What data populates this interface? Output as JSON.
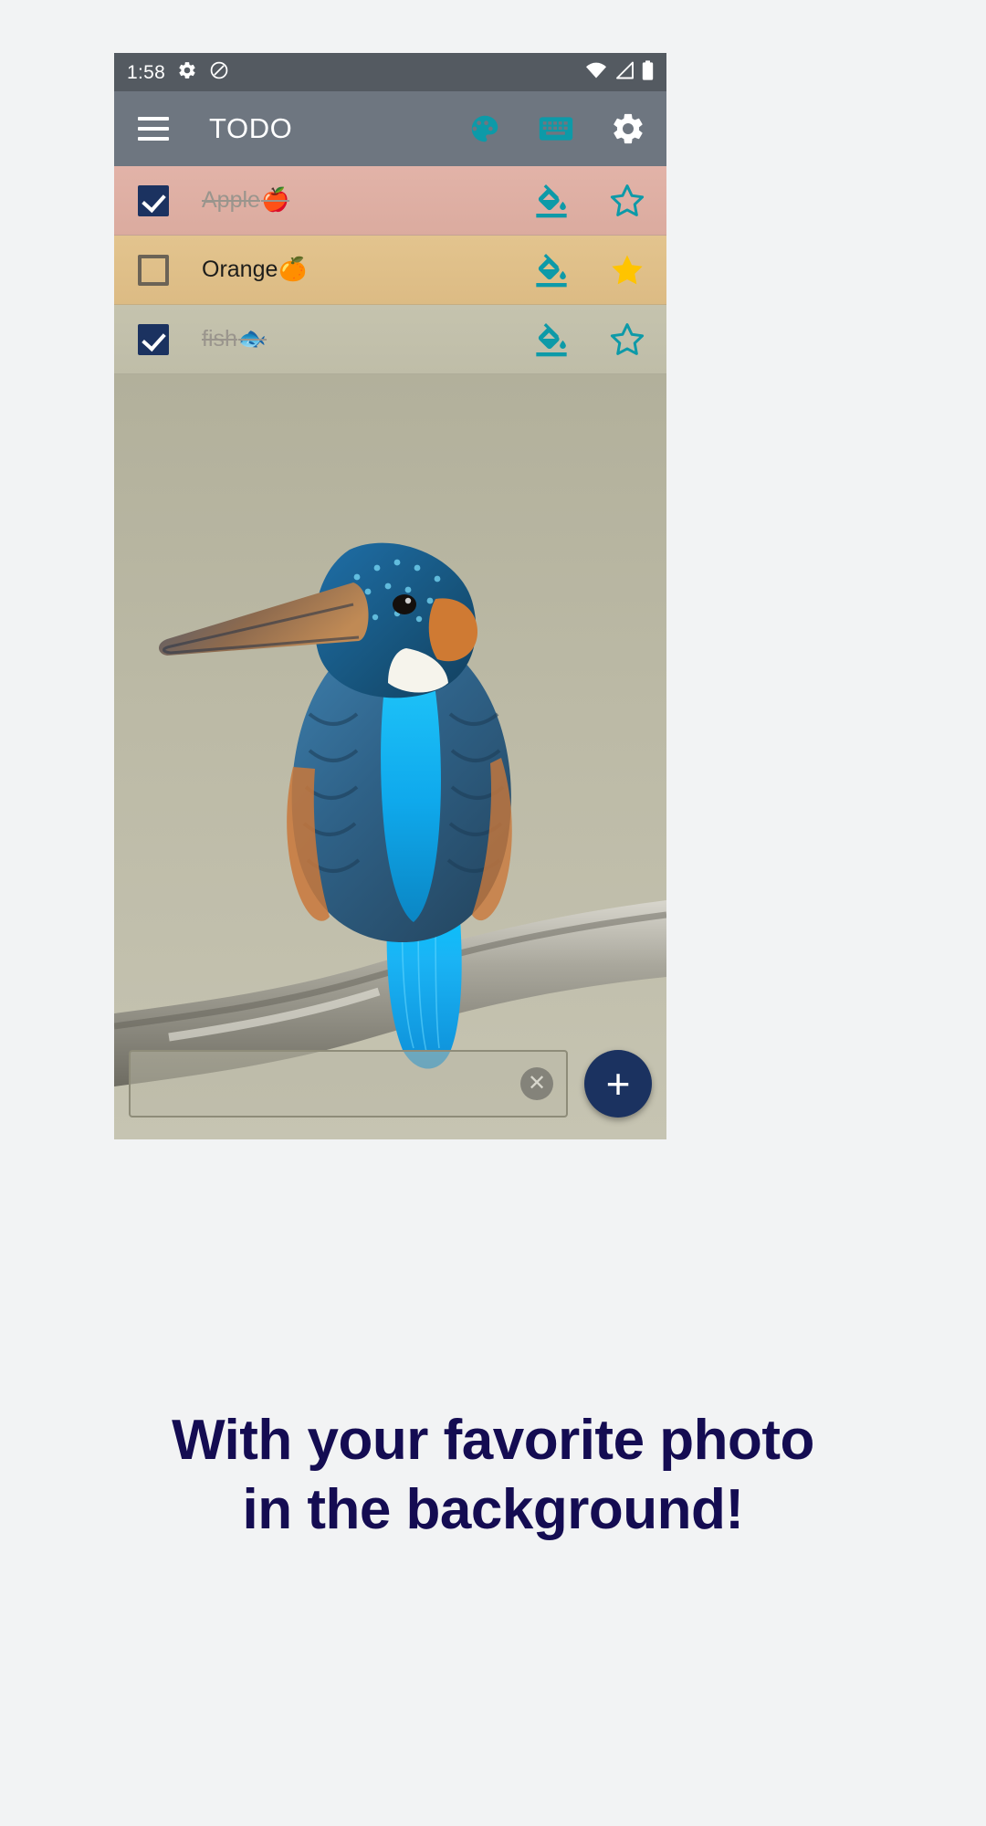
{
  "colors": {
    "page_background": "#f2f3f4",
    "status_bar": "#545a61",
    "app_bar": "#6e7680",
    "accent_teal": "#0d9aa8",
    "checkbox_checked": "#1b3260",
    "fab": "#1b3260",
    "star_filled": "#ffc400",
    "caption_text": "#140c52",
    "row_apple": "#dbab9f",
    "row_orange": "#dcbb84",
    "row_fish": "#bfbda8"
  },
  "status_bar": {
    "time": "1:58",
    "left_icons": [
      "gear-icon",
      "do-not-disturb-icon"
    ],
    "right_icons": [
      "wifi-icon",
      "signal-icon",
      "battery-icon"
    ]
  },
  "app_bar": {
    "menu_icon": "hamburger-menu-icon",
    "title": "TODO",
    "actions": [
      {
        "name": "palette-icon",
        "label": "Theme"
      },
      {
        "name": "keyboard-icon",
        "label": "Keyboard"
      },
      {
        "name": "gear-icon",
        "label": "Settings"
      }
    ]
  },
  "tasks": [
    {
      "label": "Apple",
      "emoji": "🍎",
      "checked": true,
      "starred": false,
      "row_color": "#dbab9f",
      "actions": [
        "fill-color-icon",
        "star-outline-icon"
      ]
    },
    {
      "label": "Orange",
      "emoji": "🍊",
      "checked": false,
      "starred": true,
      "row_color": "#dcbb84",
      "actions": [
        "fill-color-icon",
        "star-filled-icon"
      ]
    },
    {
      "label": "fish",
      "emoji": "🐟",
      "checked": true,
      "starred": false,
      "row_color": "#bfbda8",
      "actions": [
        "fill-color-icon",
        "star-outline-icon"
      ]
    }
  ],
  "background_photo": {
    "subject": "kingfisher-bird-on-branch"
  },
  "input_bar": {
    "value": "",
    "placeholder": "",
    "clear_icon": "clear-circle-icon",
    "add_button_label": "+"
  },
  "caption": {
    "line1": "With your favorite photo",
    "line2": "in the background!"
  }
}
